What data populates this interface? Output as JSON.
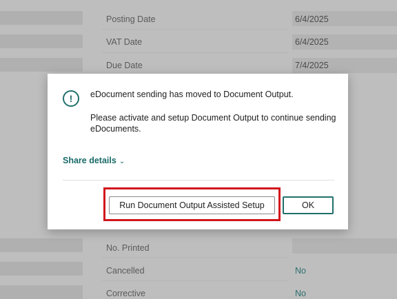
{
  "background": {
    "fields_top": [
      {
        "label": "Posting Date",
        "value": "6/4/2025"
      },
      {
        "label": "VAT Date",
        "value": "6/4/2025"
      },
      {
        "label": "Due Date",
        "value": "7/4/2025"
      }
    ],
    "fields_bottom": [
      {
        "label": "No. Printed",
        "value": ""
      },
      {
        "label": "Cancelled",
        "value": "No"
      },
      {
        "label": "Corrective",
        "value": "No"
      }
    ]
  },
  "dialog": {
    "icon": "info-icon",
    "title": "eDocument sending has moved to Document Output.",
    "body": "Please activate and setup Document Output to continue sending eDocuments.",
    "share_details": "Share details",
    "run_button": "Run Document Output Assisted Setup",
    "ok_button": "OK",
    "highlight_color": "#d1151c",
    "accent_color": "#1f6f6a"
  }
}
